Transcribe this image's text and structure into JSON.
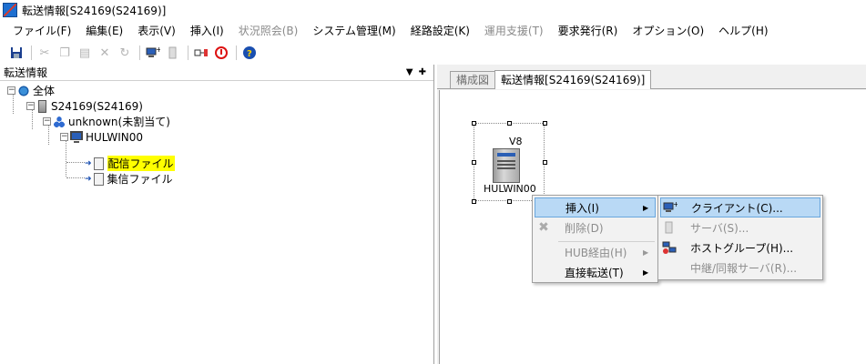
{
  "window": {
    "title": "転送情報[S24169(S24169)]"
  },
  "menu": [
    {
      "label": "ファイル(F)",
      "disabled": false
    },
    {
      "label": "編集(E)",
      "disabled": false
    },
    {
      "label": "表示(V)",
      "disabled": false
    },
    {
      "label": "挿入(I)",
      "disabled": false
    },
    {
      "label": "状況照会(B)",
      "disabled": true
    },
    {
      "label": "システム管理(M)",
      "disabled": false
    },
    {
      "label": "経路設定(K)",
      "disabled": false
    },
    {
      "label": "運用支援(T)",
      "disabled": true
    },
    {
      "label": "要求発行(R)",
      "disabled": false
    },
    {
      "label": "オプション(O)",
      "disabled": false
    },
    {
      "label": "ヘルプ(H)",
      "disabled": false
    }
  ],
  "left_pane": {
    "title": "転送情報",
    "tree": {
      "root": "全体",
      "server": "S24169(S24169)",
      "group": "unknown(未割当て)",
      "host": "HULWIN00",
      "file_distribute": "配信ファイル",
      "file_collect": "集信ファイル"
    }
  },
  "right_pane": {
    "tabs": [
      {
        "label": "構成図",
        "active": false
      },
      {
        "label": "転送情報[S24169(S24169)]",
        "active": true
      }
    ],
    "node": {
      "version": "V8",
      "name": "HULWIN00"
    }
  },
  "context_menu": {
    "insert": "挿入(I)",
    "delete": "削除(D)",
    "hub_via": "HUB経由(H)",
    "direct": "直接転送(T)"
  },
  "submenu": {
    "client": "クライアント(C)...",
    "server": "サーバ(S)...",
    "host_group": "ホストグループ(H)...",
    "relay_server": "中継/同報サーバ(R)..."
  },
  "icons": {
    "save": "save-icon",
    "cut": "cut-icon",
    "copy": "copy-icon",
    "paste": "paste-icon",
    "delete": "delete-icon",
    "refresh": "refresh-icon",
    "help": "help-icon"
  }
}
